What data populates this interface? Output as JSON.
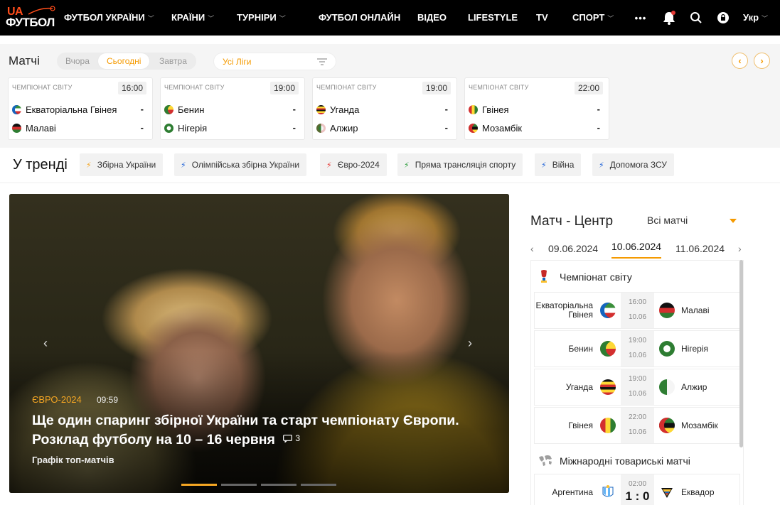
{
  "nav": {
    "logo_ua": "UA",
    "logo_main": "ФУТБОЛ",
    "items": [
      {
        "label": "ФУТБОЛ УКРАЇНИ",
        "dropdown": true
      },
      {
        "label": "КРАЇНИ",
        "dropdown": true
      },
      {
        "label": "ТУРНІРИ",
        "dropdown": true
      },
      {
        "label": "ФУТБОЛ ОНЛАЙН",
        "dropdown": false
      },
      {
        "label": "ВІДЕО",
        "dropdown": false
      },
      {
        "label": "LIFESTYLE",
        "dropdown": false
      },
      {
        "label": "TV",
        "dropdown": false
      },
      {
        "label": "СПОРТ",
        "dropdown": true
      }
    ],
    "more": "•••",
    "lang": "Укр"
  },
  "matches": {
    "title": "Матчі",
    "days": [
      "Вчора",
      "Сьогодні",
      "Завтра"
    ],
    "league_select": "Усі Ліги",
    "cards": [
      {
        "league": "ЧЕМПІОНАТ СВІТУ",
        "time": "16:00",
        "home": "Екваторіальна Гвінея",
        "away": "Малаві",
        "home_score": "-",
        "away_score": "-"
      },
      {
        "league": "ЧЕМПІОНАТ СВІТУ",
        "time": "19:00",
        "home": "Бенин",
        "away": "Нігерія",
        "home_score": "-",
        "away_score": "-"
      },
      {
        "league": "ЧЕМПІОНАТ СВІТУ",
        "time": "19:00",
        "home": "Уганда",
        "away": "Алжир",
        "home_score": "-",
        "away_score": "-"
      },
      {
        "league": "ЧЕМПІОНАТ СВІТУ",
        "time": "22:00",
        "home": "Гвінея",
        "away": "Мозамбік",
        "home_score": "-",
        "away_score": "-"
      }
    ]
  },
  "trending": {
    "title": "У тренді",
    "tags": [
      "Збірна України",
      "Олімпійська збірна України",
      "Євро-2024",
      "Пряма трансляція спорту",
      "Війна",
      "Допомога ЗСУ"
    ]
  },
  "hero": {
    "category": "ЄВРО-2024",
    "time": "09:59",
    "headline": "Ще один спаринг збірної України та старт чемпіонату Європи. Розклад футболу на 10 – 16 червня",
    "comments": "3",
    "subtitle": "Графік топ-матчів"
  },
  "match_center": {
    "title": "Матч - Центр",
    "filter": "Всі матчі",
    "dates": [
      "09.06.2024",
      "10.06.2024",
      "11.06.2024"
    ],
    "group1": "Чемпіонат світу",
    "rows1": [
      {
        "home": "Екваторіальна Гвінея",
        "t1": "16:00",
        "t2": "10.06",
        "away": "Малаві"
      },
      {
        "home": "Бенин",
        "t1": "19:00",
        "t2": "10.06",
        "away": "Нігерія"
      },
      {
        "home": "Уганда",
        "t1": "19:00",
        "t2": "10.06",
        "away": "Алжир"
      },
      {
        "home": "Гвінея",
        "t1": "22:00",
        "t2": "10.06",
        "away": "Мозамбік"
      }
    ],
    "group2": "Міжнародні товариські матчі",
    "rows2": [
      {
        "home": "Аргентина",
        "t1": "02:00",
        "score": "1 : 0",
        "away": "Еквадор"
      }
    ]
  }
}
